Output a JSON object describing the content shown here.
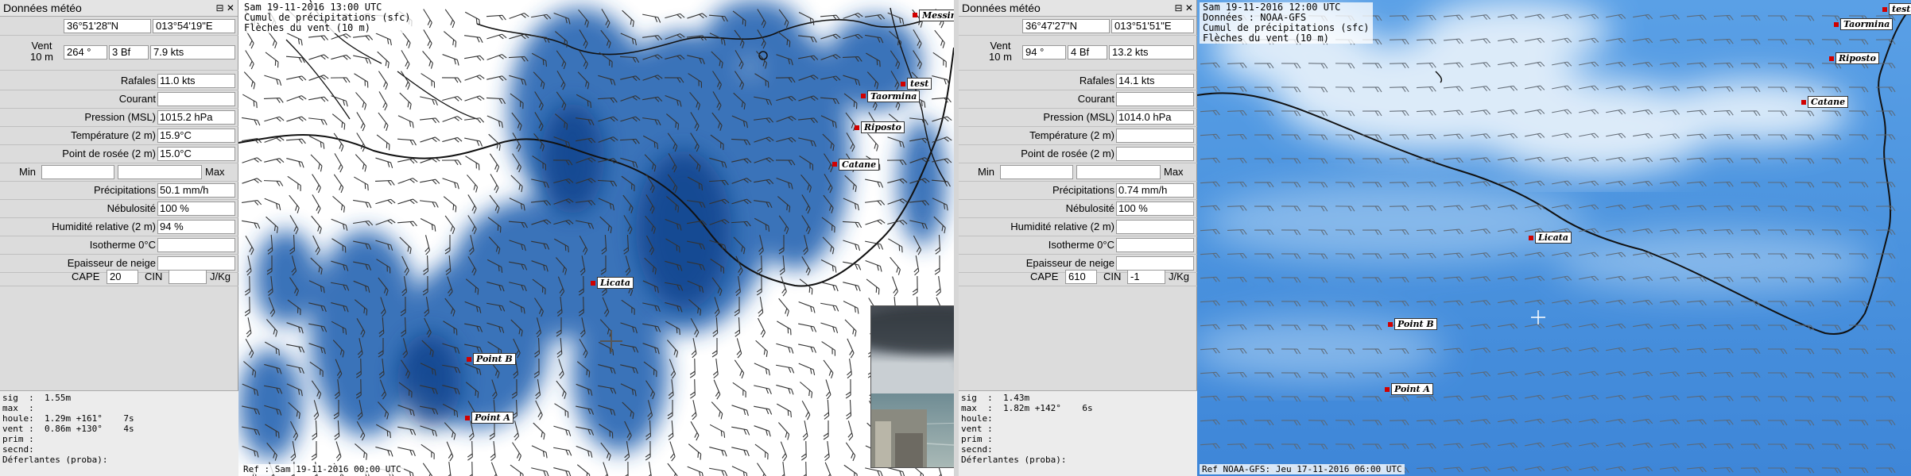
{
  "left_panel": {
    "title": "Données météo",
    "title_buttons": "⊟ ✕",
    "lat": "36°51'28\"N",
    "lon": "013°54'19\"E",
    "wind_label": "Vent\n10 m",
    "wind_dir": "264 °",
    "wind_bf": "3 Bf",
    "wind_kts": "7.9  kts",
    "rows": [
      {
        "label": "Rafales",
        "value": "11.0  kts"
      },
      {
        "label": "Courant",
        "value": ""
      },
      {
        "label": "Pression (MSL)",
        "value": "1015.2 hPa"
      },
      {
        "label": "Température (2 m)",
        "value": "15.9°C"
      },
      {
        "label": "Point de rosée (2 m)",
        "value": "15.0°C"
      },
      {
        "label": "Min / Max",
        "value": ""
      },
      {
        "label": "Précipitations",
        "value": "50.1 mm/h"
      },
      {
        "label": "Nébulosité",
        "value": "100 %"
      },
      {
        "label": "Humidité relative (2 m)",
        "value": "94 %"
      },
      {
        "label": "Isotherme 0°C",
        "value": ""
      },
      {
        "label": "Epaisseur de neige",
        "value": ""
      }
    ],
    "min_label": "Min",
    "max_label": "Max",
    "cape_label": "CAPE",
    "cape_value": "20",
    "cin_label": "CIN",
    "cin_value": "",
    "cape_unit": "J/Kg",
    "bottom_lines": [
      "sig  :  1.55m",
      "max  :",
      "houle:  1.29m +161°    7s",
      "vent :  0.86m +130°    4s",
      "prim :",
      "secnd:",
      "Déferlantes (proba):"
    ]
  },
  "left_map": {
    "head1": "Sam 19-11-2016 13:00 UTC",
    "head2": "Cumul de précipitations (sfc)",
    "head3": "Flèches du vent (10 m)",
    "ref": "Ref : Sam 19-11-2016 00:00 UTC",
    "cities": {
      "messine": "Messine",
      "test": "test",
      "taormina": "Taormina",
      "riposto": "Riposto",
      "catane": "Catane",
      "licata": "Licata",
      "pointb": "Point B",
      "pointa": "Point A"
    }
  },
  "right_panel": {
    "title": "Données météo",
    "title_buttons": "⊟ ✕",
    "lat": "36°47'27\"N",
    "lon": "013°51'51\"E",
    "wind_label": "Vent\n10 m",
    "wind_dir": "94 °",
    "wind_bf": "4 Bf",
    "wind_kts": "13.2  kts",
    "rows": [
      {
        "label": "Rafales",
        "value": "14.1  kts"
      },
      {
        "label": "Courant",
        "value": ""
      },
      {
        "label": "Pression (MSL)",
        "value": "1014.0 hPa"
      },
      {
        "label": "Température (2 m)",
        "value": ""
      },
      {
        "label": "Point de rosée (2 m)",
        "value": ""
      },
      {
        "label": "Min / Max",
        "value": ""
      },
      {
        "label": "Précipitations",
        "value": "0.74 mm/h"
      },
      {
        "label": "Nébulosité",
        "value": "100 %"
      },
      {
        "label": "Humidité relative (2 m)",
        "value": ""
      },
      {
        "label": "Isotherme 0°C",
        "value": ""
      },
      {
        "label": "Epaisseur de neige",
        "value": ""
      }
    ],
    "min_label": "Min",
    "max_label": "Max",
    "cape_label": "CAPE",
    "cape_value": "610",
    "cin_label": "CIN",
    "cin_value": "-1",
    "cape_unit": "J/Kg",
    "bottom_lines": [
      "sig  :  1.43m",
      "max  :  1.82m +142°    6s",
      "houle:",
      "vent :",
      "prim :",
      "secnd:",
      "Déferlantes (proba):"
    ]
  },
  "right_map": {
    "head1": "Sam 19-11-2016 12:00 UTC",
    "head2": "Données : NOAA-GFS",
    "head3": "Cumul de précipitations (sfc)",
    "head4": "Flèches du vent (10 m)",
    "ref": "Ref NOAA-GFS: Jeu 17-11-2016 06:00 UTC",
    "cities": {
      "test": "test",
      "taormina": "Taormina",
      "riposto": "Riposto",
      "catane": "Catane",
      "licata": "Licata",
      "pointb": "Point B",
      "pointa": "Point A"
    }
  },
  "colors": {
    "rain_dark": "#1f5aa6",
    "rain_mid": "#3f7ec4",
    "sea_light": "#cfe3f7",
    "sea_mid": "#4d95e0",
    "city_dot": "#d10000"
  }
}
